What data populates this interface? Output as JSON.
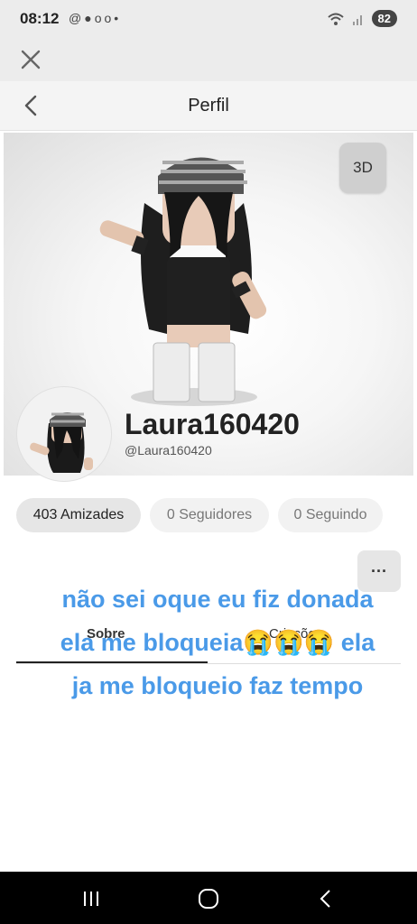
{
  "status_bar": {
    "time": "08:12",
    "notification_icons": [
      "at-icon",
      "chat-icon",
      "voicemail-icon",
      "dot-icon"
    ],
    "battery": "82"
  },
  "header": {
    "title": "Perfil"
  },
  "avatar_view": {
    "toggle_label": "3D"
  },
  "profile": {
    "display_name": "Laura160420",
    "username": "@Laura160420"
  },
  "stats": {
    "friends": "403 Amizades",
    "followers": "0 Seguidores",
    "following": "0 Seguindo"
  },
  "more_menu": "···",
  "tabs": {
    "about": "Sobre",
    "creations": "Criações"
  },
  "overlay_caption": "não sei oque eu fiz donada ela me bloqueia😭😭😭 ela ja me bloqueio faz tempo",
  "colors": {
    "caption": "#4a9ae8",
    "header_bg": "#f4f4f4",
    "nav_bar": "#000000"
  }
}
